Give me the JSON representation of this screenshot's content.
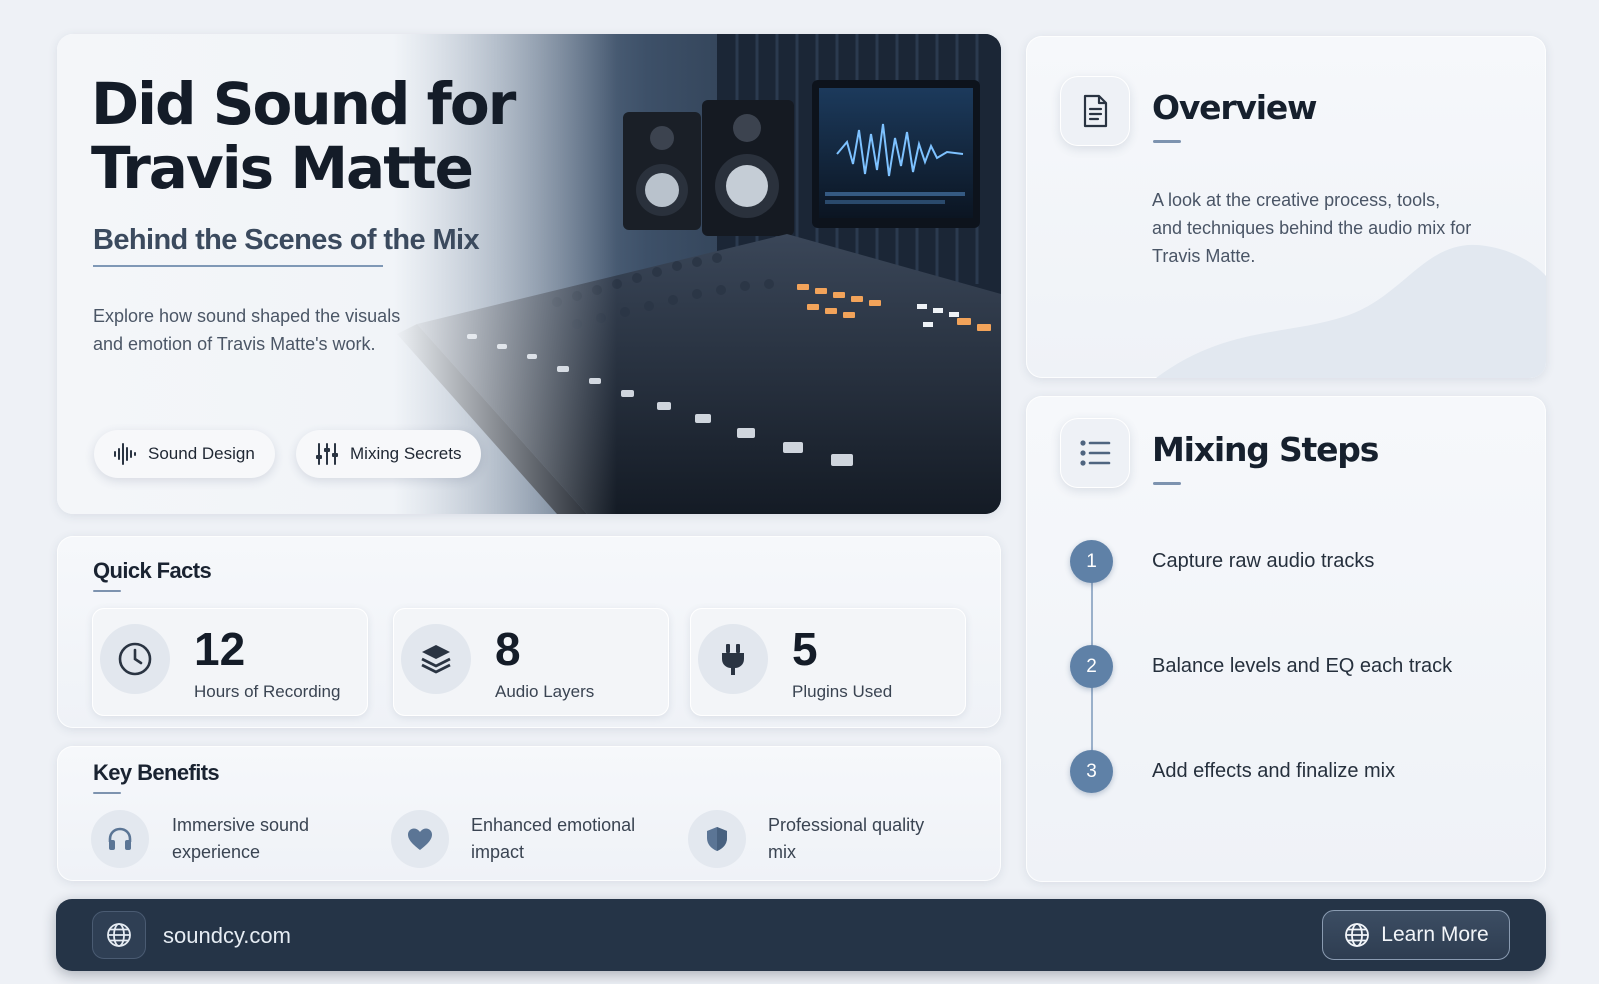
{
  "hero": {
    "title": "Did Sound for Travis Matte",
    "subtitle": "Behind the Scenes of the Mix",
    "description": "Explore how sound shaped the visuals and emotion of Travis Matte's work.",
    "tags": [
      {
        "label": "Sound Design",
        "icon": "waveform-icon"
      },
      {
        "label": "Mixing Secrets",
        "icon": "sliders-icon"
      }
    ],
    "image": "mixing-console-studio"
  },
  "overview": {
    "title": "Overview",
    "icon": "document-icon",
    "text": "A look at the creative process, tools, and techniques behind the audio mix for Travis Matte."
  },
  "mixing_steps": {
    "title": "Mixing Steps",
    "icon": "list-icon",
    "steps": [
      {
        "number": "1",
        "text": "Capture raw audio tracks"
      },
      {
        "number": "2",
        "text": "Balance levels and EQ each track"
      },
      {
        "number": "3",
        "text": "Add effects and finalize mix"
      }
    ]
  },
  "quick_facts": {
    "title": "Quick Facts",
    "items": [
      {
        "value": "12",
        "label": "Hours of Recording",
        "icon": "clock-icon"
      },
      {
        "value": "8",
        "label": "Audio Layers",
        "icon": "layers-icon"
      },
      {
        "value": "5",
        "label": "Plugins Used",
        "icon": "plug-icon"
      }
    ]
  },
  "key_benefits": {
    "title": "Key Benefits",
    "items": [
      {
        "text": "Immersive sound experience",
        "icon": "headphones-icon"
      },
      {
        "text": "Enhanced emotional impact",
        "icon": "heart-icon"
      },
      {
        "text": "Professional quality mix",
        "icon": "shield-icon"
      }
    ]
  },
  "footer": {
    "url": "soundcy.com",
    "button_label": "Learn More",
    "icon": "globe-icon"
  },
  "colors": {
    "accent": "#5f81a7",
    "footer_bg": "#253447",
    "page_bg": "#eef1f6"
  }
}
